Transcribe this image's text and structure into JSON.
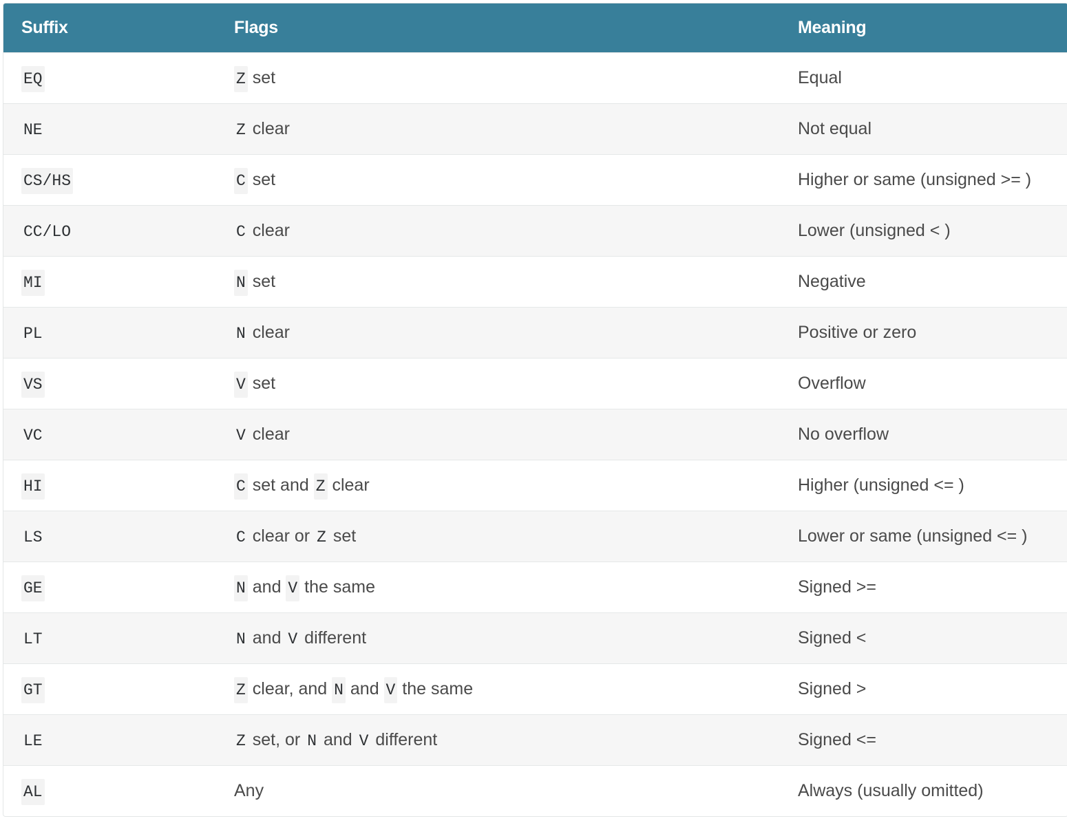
{
  "header": {
    "suffix": "Suffix",
    "flags": "Flags",
    "meaning": "Meaning"
  },
  "colors": {
    "header_bg": "#387f9a",
    "header_text": "#ffffff",
    "row_alt": "#f6f6f6"
  },
  "rows": [
    {
      "suffix": "EQ",
      "flags": [
        [
          "code",
          "Z"
        ],
        [
          "text",
          " set"
        ]
      ],
      "meaning": "Equal"
    },
    {
      "suffix": "NE",
      "flags": [
        [
          "code",
          "Z"
        ],
        [
          "text",
          " clear"
        ]
      ],
      "meaning": "Not equal"
    },
    {
      "suffix": "CS/HS",
      "flags": [
        [
          "code",
          "C"
        ],
        [
          "text",
          " set"
        ]
      ],
      "meaning": "Higher or same (unsigned >= )"
    },
    {
      "suffix": "CC/LO",
      "flags": [
        [
          "code",
          "C"
        ],
        [
          "text",
          " clear"
        ]
      ],
      "meaning": "Lower (unsigned < )"
    },
    {
      "suffix": "MI",
      "flags": [
        [
          "code",
          "N"
        ],
        [
          "text",
          " set"
        ]
      ],
      "meaning": "Negative"
    },
    {
      "suffix": "PL",
      "flags": [
        [
          "code",
          "N"
        ],
        [
          "text",
          " clear"
        ]
      ],
      "meaning": "Positive or zero"
    },
    {
      "suffix": "VS",
      "flags": [
        [
          "code",
          "V"
        ],
        [
          "text",
          " set"
        ]
      ],
      "meaning": "Overflow"
    },
    {
      "suffix": "VC",
      "flags": [
        [
          "code",
          "V"
        ],
        [
          "text",
          " clear"
        ]
      ],
      "meaning": "No overflow"
    },
    {
      "suffix": "HI",
      "flags": [
        [
          "code",
          "C"
        ],
        [
          "text",
          " set and "
        ],
        [
          "code",
          "Z"
        ],
        [
          "text",
          " clear"
        ]
      ],
      "meaning": "Higher (unsigned <= )"
    },
    {
      "suffix": "LS",
      "flags": [
        [
          "code",
          "C"
        ],
        [
          "text",
          " clear or "
        ],
        [
          "code",
          "Z"
        ],
        [
          "text",
          " set"
        ]
      ],
      "meaning": "Lower or same (unsigned <= )"
    },
    {
      "suffix": "GE",
      "flags": [
        [
          "code",
          "N"
        ],
        [
          "text",
          " and "
        ],
        [
          "code",
          "V"
        ],
        [
          "text",
          " the same"
        ]
      ],
      "meaning": "Signed >="
    },
    {
      "suffix": "LT",
      "flags": [
        [
          "code",
          "N"
        ],
        [
          "text",
          " and "
        ],
        [
          "code",
          "V"
        ],
        [
          "text",
          " different"
        ]
      ],
      "meaning": "Signed <"
    },
    {
      "suffix": "GT",
      "flags": [
        [
          "code",
          "Z"
        ],
        [
          "text",
          " clear, and "
        ],
        [
          "code",
          "N"
        ],
        [
          "text",
          " and "
        ],
        [
          "code",
          "V"
        ],
        [
          "text",
          " the same"
        ]
      ],
      "meaning": "Signed >"
    },
    {
      "suffix": "LE",
      "flags": [
        [
          "code",
          "Z"
        ],
        [
          "text",
          " set, or "
        ],
        [
          "code",
          "N"
        ],
        [
          "text",
          " and "
        ],
        [
          "code",
          "V"
        ],
        [
          "text",
          " different"
        ]
      ],
      "meaning": "Signed <="
    },
    {
      "suffix": "AL",
      "flags": [
        [
          "text",
          "Any"
        ]
      ],
      "meaning": "Always (usually omitted)"
    }
  ]
}
